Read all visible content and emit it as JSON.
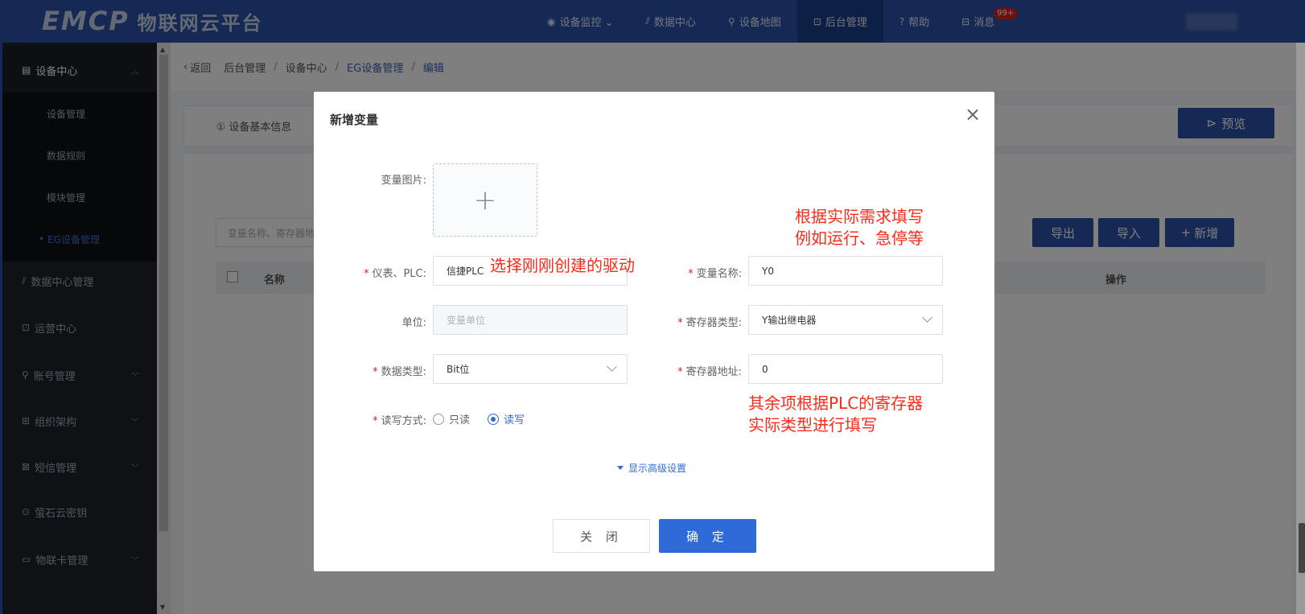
{
  "header": {
    "logo_mark": "EMCP",
    "logo_text": "物联网云平台",
    "nav": [
      {
        "icon": "◉",
        "label": "设备监控 ⌄"
      },
      {
        "icon": "⫽",
        "label": "数据中心"
      },
      {
        "icon": "⚲",
        "label": "设备地图"
      },
      {
        "icon": "⊡",
        "label": "后台管理"
      },
      {
        "icon": "?",
        "label": "帮助"
      },
      {
        "icon": "⊟",
        "label": "消息"
      }
    ],
    "message_badge": "99+"
  },
  "sidebar": {
    "groups": [
      {
        "label": "设备中心"
      },
      {
        "label": "数据中心管理"
      },
      {
        "label": "运营中心"
      },
      {
        "label": "账号管理"
      },
      {
        "label": "组织架构"
      },
      {
        "label": "短信管理"
      },
      {
        "label": "萤石云密钥"
      },
      {
        "label": "物联卡管理"
      }
    ],
    "sub_items": [
      {
        "label": "设备管理"
      },
      {
        "label": "数据规则"
      },
      {
        "label": "模块管理"
      },
      {
        "label": "EG设备管理"
      }
    ]
  },
  "breadcrumb": {
    "back": "返回",
    "items": [
      "后台管理",
      "设备中心",
      "EG设备管理",
      "编辑"
    ]
  },
  "page": {
    "tab_basic": "① 设备基本信息",
    "preview_button": "预览",
    "search_placeholder": "变量名称、寄存器地址",
    "export_button": "导出",
    "import_button": "导入",
    "add_button": "新增",
    "table_headers": {
      "name": "名称",
      "operation": "操作"
    }
  },
  "dialog": {
    "title": "新增变量",
    "close_icon": "×",
    "image_label": "变量图片:",
    "upload_plus": "+",
    "device_label": "仪表、PLC:",
    "device_value": "信捷PLC",
    "var_name_label": "变量名称:",
    "var_name_value": "Y0",
    "unit_label": "单位:",
    "unit_placeholder": "变量单位",
    "reg_type_label": "寄存器类型:",
    "reg_type_value": "Y输出继电器",
    "data_type_label": "数据类型:",
    "data_type_value": "Bit位",
    "reg_addr_label": "寄存器地址:",
    "reg_addr_value": "0",
    "rw_label": "读写方式:",
    "rw_options": [
      "只读",
      "读写"
    ],
    "rw_selected": "读写",
    "advanced": "显示高级设置",
    "cancel_button": "关 闭",
    "confirm_button": "确 定"
  },
  "annotations": {
    "note1": "选择刚刚创建的驱动",
    "note2_line1": "根据实际需求填写",
    "note2_line2": "例如运行、急停等",
    "note3_line1": "其余项根据PLC的寄存器",
    "note3_line2": "实际类型进行填写"
  },
  "colors": {
    "brand": "#2a52a8",
    "primary": "#2f6bd8",
    "annotation": "#ff2a1a",
    "sidebar_bg": "#1f2329"
  }
}
